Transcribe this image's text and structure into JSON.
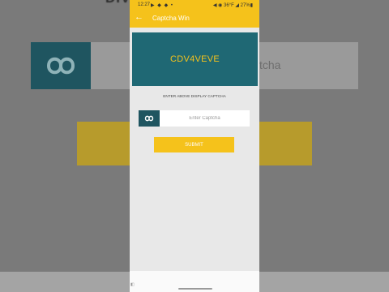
{
  "background": {
    "title_fragment": "DIVIN    CAPTCHA",
    "input_fragment": "tcha"
  },
  "statusbar": {
    "time": "12:27",
    "icons": "▶ ◆ ◆ •",
    "right": "◀ ◉ 36°F ◢ 27%▮"
  },
  "toolbar": {
    "back_icon": "back-arrow-icon",
    "title": "Captcha Win"
  },
  "captcha": {
    "code": "CDV4VEVE"
  },
  "instruction": "ENTER ABOVE DISPLAY CAPTCHA",
  "input": {
    "value": "",
    "placeholder": "Enter Captcha",
    "logo_icon": "infinity-logo-icon"
  },
  "submit": {
    "label": "SUBMIT"
  },
  "colors": {
    "accent": "#f5c21b",
    "panel": "#1f6874",
    "logo": "#1f5560",
    "background": "#e8e8e8"
  }
}
